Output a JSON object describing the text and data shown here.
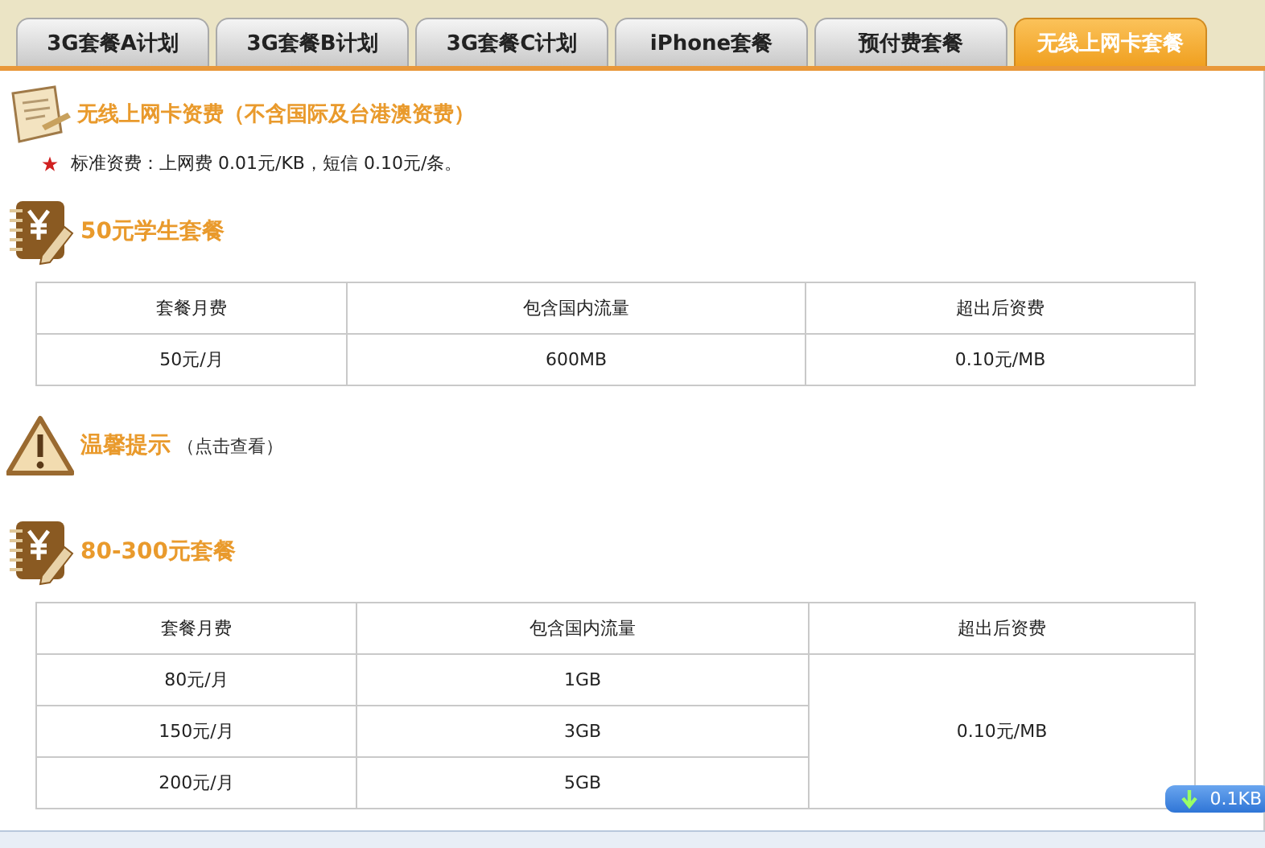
{
  "tabs": [
    {
      "label": "3G套餐A计划",
      "selected": false
    },
    {
      "label": "3G套餐B计划",
      "selected": false
    },
    {
      "label": "3G套餐C计划",
      "selected": false
    },
    {
      "label": "iPhone套餐",
      "selected": false
    },
    {
      "label": "预付费套餐",
      "selected": false
    },
    {
      "label": "无线上网卡套餐",
      "selected": true
    }
  ],
  "notice": {
    "title": "无线上网卡资费（不含国际及台港澳资费）",
    "bullet": "标准资费：上网费 0.01元/KB，短信 0.10元/条。"
  },
  "blocks": [
    {
      "kind": "plan",
      "title": "50元学生套餐",
      "columns": [
        "套餐月费",
        "包含国内流量",
        "超出后资费"
      ],
      "rows": [
        {
          "fee": "50元/月",
          "data": "600MB"
        }
      ],
      "extra": "0.10元/MB"
    },
    {
      "kind": "tip",
      "title": "温馨提示",
      "note": "（点击查看）"
    },
    {
      "kind": "plan",
      "title": "80-300元套餐",
      "columns": [
        "套餐月费",
        "包含国内流量",
        "超出后资费"
      ],
      "rows": [
        {
          "fee": "80元/月",
          "data": "1GB"
        },
        {
          "fee": "150元/月",
          "data": "3GB"
        },
        {
          "fee": "200元/月",
          "data": "5GB"
        }
      ],
      "extra": "0.10元/MB"
    }
  ],
  "speed_badge": "0.1KB"
}
